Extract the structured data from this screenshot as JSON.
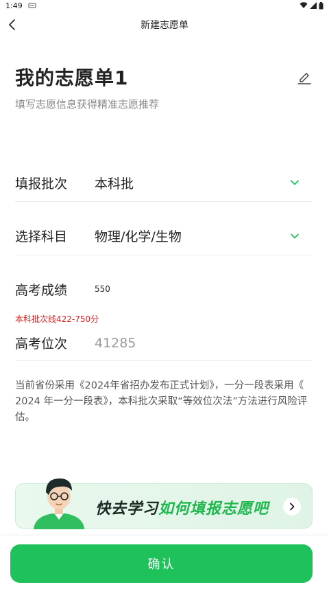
{
  "status_bar": {
    "time": "1:49"
  },
  "nav": {
    "title": "新建志愿单"
  },
  "header": {
    "title": "我的志愿单1",
    "subtitle": "填写志愿信息获得精准志愿推荐"
  },
  "form": {
    "batch": {
      "label": "填报批次",
      "value": "本科批"
    },
    "subject": {
      "label": "选择科目",
      "value": "物理/化学/生物"
    },
    "score": {
      "label": "高考成绩",
      "value": "550"
    },
    "score_hint": "本科批次线422-750分",
    "rank": {
      "label": "高考位次",
      "value": "41285"
    }
  },
  "notice": "当前省份采用《2024年省招办发布正式计划》，一分一段表采用《 2024 年一分一段表》，本科批次采取“等效位次法”方法进行风险评估。",
  "banner": {
    "text_dark": "快去学习",
    "text_green": "如何填报志愿吧"
  },
  "footer": {
    "confirm_label": "确认"
  },
  "colors": {
    "accent": "#1ec15a",
    "hint_red": "#e02020"
  },
  "icons": [
    "back-arrow-icon",
    "edit-pencil-icon",
    "chevron-down-icon",
    "chevron-right-icon",
    "wifi-icon",
    "signal-icon",
    "battery-icon"
  ]
}
